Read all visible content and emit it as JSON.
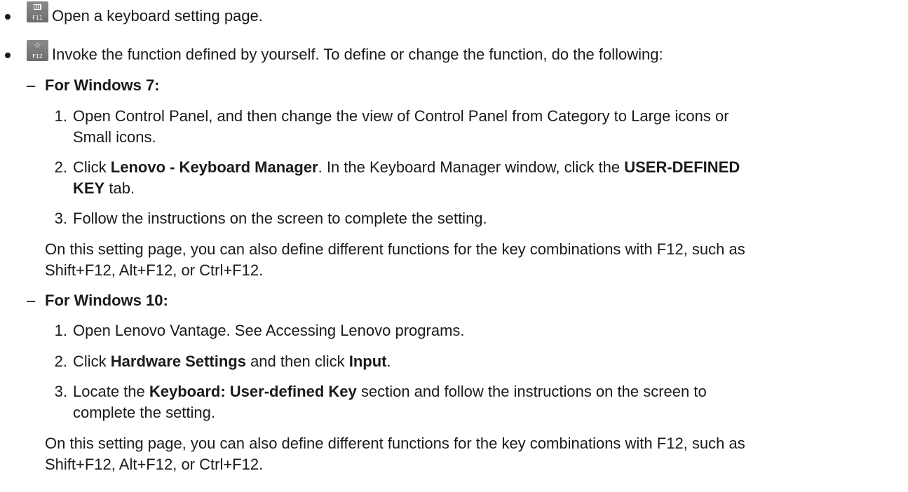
{
  "items": [
    {
      "key_cap": "F11",
      "key_icon": "keyboard-icon",
      "text": "Open a keyboard setting page."
    },
    {
      "key_cap": "F12",
      "key_icon": "star-icon",
      "text": "Invoke the function defined by yourself. To define or change the function, do the following:"
    }
  ],
  "win7": {
    "dash": "–",
    "heading": "For Windows 7:",
    "steps": [
      {
        "num": "1.",
        "line1": "Open Control Panel, and then change the view of Control Panel from Category to Large icons or",
        "line2": "Small icons."
      },
      {
        "num": "2.",
        "pre": "Click ",
        "b1": "Lenovo - Keyboard Manager",
        "mid": ". In the Keyboard Manager window, click the ",
        "b2": "USER-DEFINED",
        "b3": "KEY",
        "post": " tab."
      },
      {
        "num": "3.",
        "line1": "Follow the instructions on the screen to complete the setting."
      }
    ],
    "note_line1": "On this setting page, you can also define different functions for the key combinations with F12, such as",
    "note_line2": "Shift+F12, Alt+F12, or Ctrl+F12."
  },
  "win10": {
    "dash": "–",
    "heading": "For Windows 10:",
    "steps": [
      {
        "num": "1.",
        "line1": "Open Lenovo Vantage. See Accessing Lenovo programs."
      },
      {
        "num": "2.",
        "pre": "Click ",
        "b1": "Hardware Settings",
        "mid": " and then click ",
        "b2": "Input",
        "post": "."
      },
      {
        "num": "3.",
        "pre": "Locate the ",
        "b1": "Keyboard: User-defined Key",
        "post": " section and follow the instructions on the screen to",
        "line2": "complete the setting."
      }
    ],
    "note_line1": "On this setting page, you can also define different functions for the key combinations with F12, such as",
    "note_line2": "Shift+F12, Alt+F12, or Ctrl+F12."
  }
}
